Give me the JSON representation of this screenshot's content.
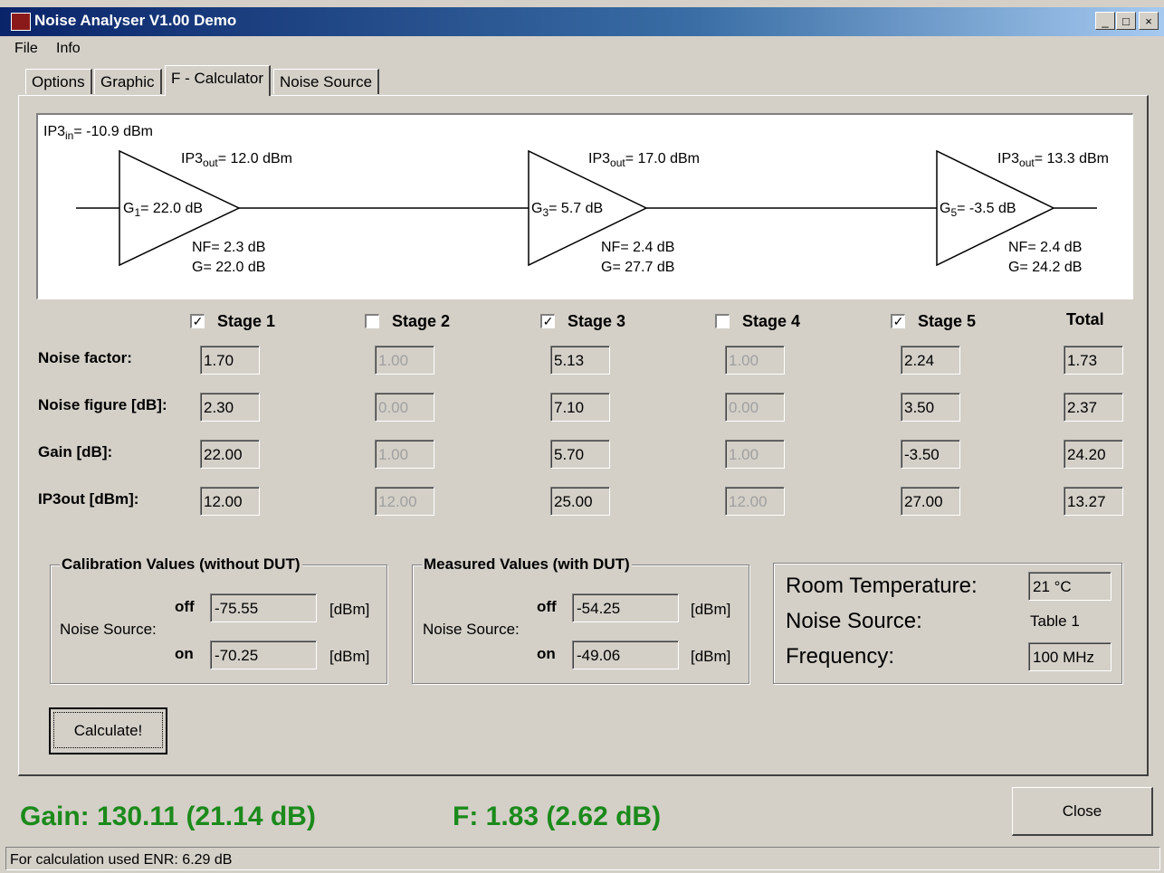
{
  "window": {
    "title": "Noise Analyser V1.00 Demo",
    "minimize": "_",
    "maximize": "□",
    "close": "×"
  },
  "menu": [
    "File",
    "Info"
  ],
  "tabs": [
    "Options",
    "Graphic",
    "F - Calculator",
    "Noise Source"
  ],
  "diagram": {
    "ip3_in": "= -10.9 dBm",
    "stages": [
      {
        "ip3_out": "= 12.0 dBm",
        "gain_sub": "1",
        "gain": "= 22.0 dB",
        "nf": "NF= 2.3 dB",
        "g": "G= 22.0 dB"
      },
      {
        "ip3_out": "= 17.0 dBm",
        "gain_sub": "3",
        "gain": "= 5.7 dB",
        "nf": "NF= 2.4 dB",
        "g": "G= 27.7 dB"
      },
      {
        "ip3_out": "= 13.3 dBm",
        "gain_sub": "5",
        "gain": "= -3.5 dB",
        "nf": "NF= 2.4 dB",
        "g": "G= 24.2 dB"
      }
    ]
  },
  "table": {
    "stages": [
      {
        "label": "Stage 1",
        "checked": true
      },
      {
        "label": "Stage 2",
        "checked": false
      },
      {
        "label": "Stage 3",
        "checked": true
      },
      {
        "label": "Stage 4",
        "checked": false
      },
      {
        "label": "Stage 5",
        "checked": true
      }
    ],
    "total_label": "Total",
    "rows": [
      {
        "label": "Noise factor:",
        "values": [
          "1.70",
          "1.00",
          "5.13",
          "1.00",
          "2.24",
          "1.73"
        ]
      },
      {
        "label": "Noise figure [dB]:",
        "values": [
          "2.30",
          "0.00",
          "7.10",
          "0.00",
          "3.50",
          "2.37"
        ]
      },
      {
        "label": "Gain [dB]:",
        "values": [
          "22.00",
          "1.00",
          "5.70",
          "1.00",
          "-3.50",
          "24.20"
        ]
      },
      {
        "label": "IP3out [dBm]:",
        "values": [
          "12.00",
          "12.00",
          "25.00",
          "12.00",
          "27.00",
          "13.27"
        ]
      }
    ]
  },
  "calibration": {
    "title": "Calibration Values (without DUT)",
    "source_label": "Noise Source:",
    "off_label": "off",
    "on_label": "on",
    "off_value": "-75.55",
    "on_value": "-70.25",
    "unit": "[dBm]"
  },
  "measured": {
    "title": "Measured Values (with DUT)",
    "source_label": "Noise Source:",
    "off_label": "off",
    "on_label": "on",
    "off_value": "-54.25",
    "on_value": "-49.06",
    "unit": "[dBm]"
  },
  "env": {
    "room_temp_label": "Room Temperature:",
    "room_temp_value": "21 °C",
    "noise_source_label": "Noise Source:",
    "noise_source_value": "Table 1",
    "frequency_label": "Frequency:",
    "frequency_value": "100 MHz"
  },
  "calculate_button": "Calculate!",
  "results": {
    "gain": "Gain: 130.11  (21.14 dB)",
    "f": "F: 1.83  (2.62 dB)"
  },
  "close_button": "Close",
  "status": "For calculation used ENR: 6.29 dB",
  "colors": {
    "title_bar": "#0a246a",
    "result_text": "#1b8a1b",
    "face": "#d4d0c8"
  }
}
